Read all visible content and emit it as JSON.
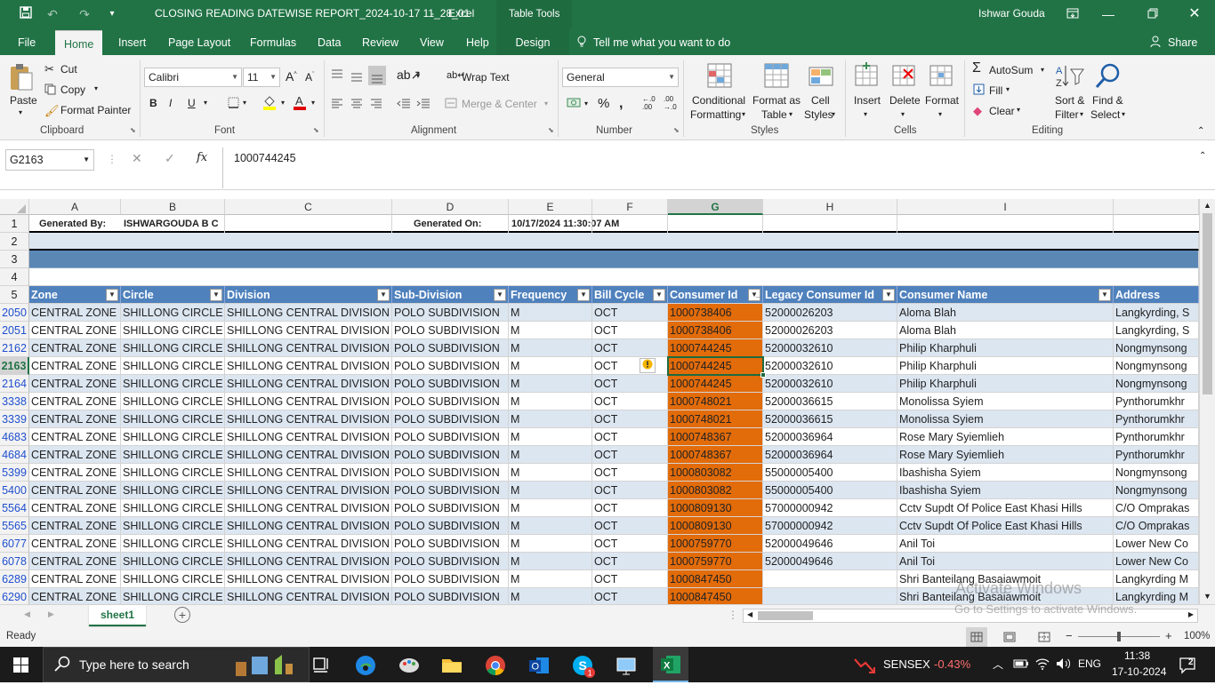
{
  "titlebar": {
    "filename": "CLOSING READING DATEWISE REPORT_2024-10-17 11_28_01",
    "sep": "-",
    "app": "Excel",
    "context": "Table Tools",
    "user": "Ishwar Gouda"
  },
  "tabs": [
    "File",
    "Home",
    "Insert",
    "Page Layout",
    "Formulas",
    "Data",
    "Review",
    "View",
    "Help",
    "Design"
  ],
  "tellme": "Tell me what you want to do",
  "share": "Share",
  "ribbon": {
    "paste": "Paste",
    "cut": "Cut",
    "copy": "Copy",
    "format_painter": "Format Painter",
    "clipboard": "Clipboard",
    "font_name": "Calibri",
    "font_size": "11",
    "font": "Font",
    "wrap_text": "Wrap Text",
    "merge_center": "Merge & Center",
    "alignment": "Alignment",
    "number_format": "General",
    "number": "Number",
    "conditional": "Conditional",
    "formatting": "Formatting",
    "format_as": "Format as",
    "table": "Table",
    "cell": "Cell",
    "styles_btn": "Styles",
    "styles": "Styles",
    "insert": "Insert",
    "delete": "Delete",
    "format": "Format",
    "cells": "Cells",
    "autosum": "AutoSum",
    "fill": "Fill",
    "clear": "Clear",
    "sort": "Sort &",
    "filter": "Filter",
    "find": "Find &",
    "select": "Select",
    "editing": "Editing"
  },
  "namebox": "G2163",
  "formula": "1000744245",
  "columns": [
    "A",
    "B",
    "C",
    "D",
    "E",
    "F",
    "G",
    "H",
    "I"
  ],
  "row1": {
    "generated_by_label": "Generated By:",
    "generated_by": "ISHWARGOUDA B C",
    "generated_on_label": "Generated On:",
    "generated_on": "10/17/2024 11:30:07 AM"
  },
  "header_row": [
    "Zone",
    "Circle",
    "Division",
    "Sub-Division",
    "Frequency",
    "Bill Cycle",
    "Consumer Id",
    "Legacy Consumer Id",
    "Consumer Name",
    "Address"
  ],
  "top_rows": [
    "1",
    "2",
    "3",
    "4",
    "5"
  ],
  "rows": [
    {
      "r": "2050",
      "zone": "CENTRAL ZONE",
      "circle": "SHILLONG CIRCLE",
      "division": "SHILLONG CENTRAL DIVISION",
      "sub": "POLO  SUBDIVISION",
      "freq": "M",
      "cycle": "OCT",
      "cid": "1000738406",
      "legacy": "52000026203",
      "name": "Aloma  Blah",
      "addr": "Langkyrding, S"
    },
    {
      "r": "2051",
      "zone": "CENTRAL ZONE",
      "circle": "SHILLONG CIRCLE",
      "division": "SHILLONG CENTRAL DIVISION",
      "sub": "POLO  SUBDIVISION",
      "freq": "M",
      "cycle": "OCT",
      "cid": "1000738406",
      "legacy": "52000026203",
      "name": "Aloma  Blah",
      "addr": "Langkyrding, S"
    },
    {
      "r": "2162",
      "zone": "CENTRAL ZONE",
      "circle": "SHILLONG CIRCLE",
      "division": "SHILLONG CENTRAL DIVISION",
      "sub": "POLO  SUBDIVISION",
      "freq": "M",
      "cycle": "OCT",
      "cid": "1000744245",
      "legacy": "52000032610",
      "name": "Philip  Kharphuli",
      "addr": "Nongmynsong"
    },
    {
      "r": "2163",
      "zone": "CENTRAL ZONE",
      "circle": "SHILLONG CIRCLE",
      "division": "SHILLONG CENTRAL DIVISION",
      "sub": "POLO  SUBDIVISION",
      "freq": "M",
      "cycle": "OCT",
      "cid": "1000744245",
      "legacy": "52000032610",
      "name": "Philip  Kharphuli",
      "addr": "Nongmynsong"
    },
    {
      "r": "2164",
      "zone": "CENTRAL ZONE",
      "circle": "SHILLONG CIRCLE",
      "division": "SHILLONG CENTRAL DIVISION",
      "sub": "POLO  SUBDIVISION",
      "freq": "M",
      "cycle": "OCT",
      "cid": "1000744245",
      "legacy": "52000032610",
      "name": "Philip  Kharphuli",
      "addr": "Nongmynsong"
    },
    {
      "r": "3338",
      "zone": "CENTRAL ZONE",
      "circle": "SHILLONG CIRCLE",
      "division": "SHILLONG CENTRAL DIVISION",
      "sub": "POLO  SUBDIVISION",
      "freq": "M",
      "cycle": "OCT",
      "cid": "1000748021",
      "legacy": "52000036615",
      "name": "Monolissa  Syiem",
      "addr": "Pynthorumkhr"
    },
    {
      "r": "3339",
      "zone": "CENTRAL ZONE",
      "circle": "SHILLONG CIRCLE",
      "division": "SHILLONG CENTRAL DIVISION",
      "sub": "POLO  SUBDIVISION",
      "freq": "M",
      "cycle": "OCT",
      "cid": "1000748021",
      "legacy": "52000036615",
      "name": "Monolissa  Syiem",
      "addr": "Pynthorumkhr"
    },
    {
      "r": "4683",
      "zone": "CENTRAL ZONE",
      "circle": "SHILLONG CIRCLE",
      "division": "SHILLONG CENTRAL DIVISION",
      "sub": "POLO  SUBDIVISION",
      "freq": "M",
      "cycle": "OCT",
      "cid": "1000748367",
      "legacy": "52000036964",
      "name": "Rose Mary Syiemlieh",
      "addr": "Pynthorumkhr"
    },
    {
      "r": "4684",
      "zone": "CENTRAL ZONE",
      "circle": "SHILLONG CIRCLE",
      "division": "SHILLONG CENTRAL DIVISION",
      "sub": "POLO  SUBDIVISION",
      "freq": "M",
      "cycle": "OCT",
      "cid": "1000748367",
      "legacy": "52000036964",
      "name": "Rose Mary Syiemlieh",
      "addr": "Pynthorumkhr"
    },
    {
      "r": "5399",
      "zone": "CENTRAL ZONE",
      "circle": "SHILLONG CIRCLE",
      "division": "SHILLONG CENTRAL DIVISION",
      "sub": "POLO  SUBDIVISION",
      "freq": "M",
      "cycle": "OCT",
      "cid": "1000803082",
      "legacy": "55000005400",
      "name": "Ibashisha  Syiem",
      "addr": "Nongmynsong"
    },
    {
      "r": "5400",
      "zone": "CENTRAL ZONE",
      "circle": "SHILLONG CIRCLE",
      "division": "SHILLONG CENTRAL DIVISION",
      "sub": "POLO  SUBDIVISION",
      "freq": "M",
      "cycle": "OCT",
      "cid": "1000803082",
      "legacy": "55000005400",
      "name": "Ibashisha  Syiem",
      "addr": "Nongmynsong"
    },
    {
      "r": "5564",
      "zone": "CENTRAL ZONE",
      "circle": "SHILLONG CIRCLE",
      "division": "SHILLONG CENTRAL DIVISION",
      "sub": "POLO  SUBDIVISION",
      "freq": "M",
      "cycle": "OCT",
      "cid": "1000809130",
      "legacy": "57000000942",
      "name": "Cctv Supdt Of Police East Khasi Hills",
      "addr": "C/O Omprakas"
    },
    {
      "r": "5565",
      "zone": "CENTRAL ZONE",
      "circle": "SHILLONG CIRCLE",
      "division": "SHILLONG CENTRAL DIVISION",
      "sub": "POLO  SUBDIVISION",
      "freq": "M",
      "cycle": "OCT",
      "cid": "1000809130",
      "legacy": "57000000942",
      "name": "Cctv Supdt Of Police East Khasi Hills",
      "addr": "C/O Omprakas"
    },
    {
      "r": "6077",
      "zone": "CENTRAL ZONE",
      "circle": "SHILLONG CIRCLE",
      "division": "SHILLONG CENTRAL DIVISION",
      "sub": "POLO  SUBDIVISION",
      "freq": "M",
      "cycle": "OCT",
      "cid": "1000759770",
      "legacy": "52000049646",
      "name": "Anil  Toi",
      "addr": "Lower New Co"
    },
    {
      "r": "6078",
      "zone": "CENTRAL ZONE",
      "circle": "SHILLONG CIRCLE",
      "division": "SHILLONG CENTRAL DIVISION",
      "sub": "POLO  SUBDIVISION",
      "freq": "M",
      "cycle": "OCT",
      "cid": "1000759770",
      "legacy": "52000049646",
      "name": "Anil  Toi",
      "addr": "Lower New Co"
    },
    {
      "r": "6289",
      "zone": "CENTRAL ZONE",
      "circle": "SHILLONG CIRCLE",
      "division": "SHILLONG CENTRAL DIVISION",
      "sub": "POLO  SUBDIVISION",
      "freq": "M",
      "cycle": "OCT",
      "cid": "1000847450",
      "legacy": "",
      "name": "Shri Banteilang Basaiawmoit",
      "addr": "Langkyrding M"
    },
    {
      "r": "6290",
      "zone": "CENTRAL ZONE",
      "circle": "SHILLONG CIRCLE",
      "division": "SHILLONG CENTRAL DIVISION",
      "sub": "POLO  SUBDIVISION",
      "freq": "M",
      "cycle": "OCT",
      "cid": "1000847450",
      "legacy": "",
      "name": "Shri Banteilang Basaiawmoit",
      "addr": "Langkyrding M"
    }
  ],
  "sheet_tab": "sheet1",
  "watermark": {
    "line1": "Activate Windows",
    "line2": "Go to Settings to activate Windows."
  },
  "status": {
    "ready": "Ready",
    "zoom": "100%"
  },
  "taskbar": {
    "search": "Type here to search",
    "sensex": "SENSEX",
    "sensex_change": "-0.43%",
    "lang": "ENG",
    "time": "11:38",
    "date": "17-10-2024",
    "notif": "2"
  },
  "colors": {
    "excel_green": "#217346",
    "header_blue": "#4f81bd",
    "band": "#dce6f1",
    "highlight": "#e26b0a"
  }
}
